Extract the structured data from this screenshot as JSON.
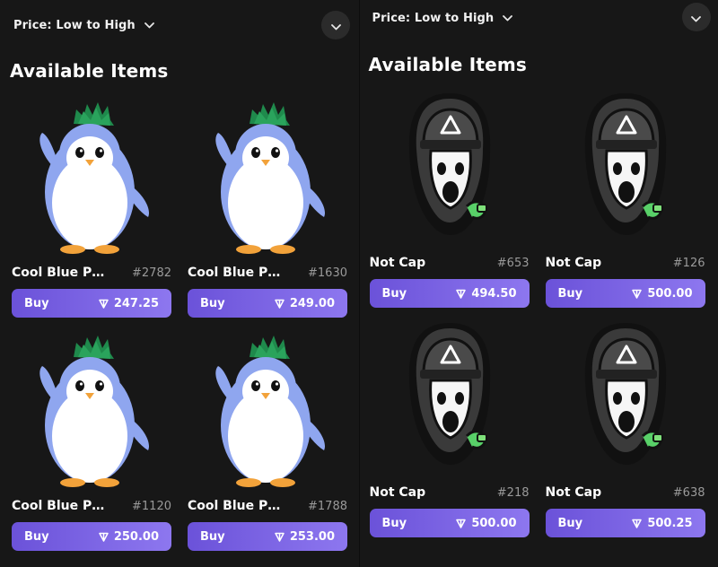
{
  "left_panel": {
    "sort": {
      "label": "Price: Low to High"
    },
    "section_title": "Available Items",
    "items": [
      {
        "name": "Cool Blue Pe...",
        "number": "#2782",
        "buy_label": "Buy",
        "price": "247.25",
        "art": "penguin"
      },
      {
        "name": "Cool Blue Pe...",
        "number": "#1630",
        "buy_label": "Buy",
        "price": "249.00",
        "art": "penguin"
      },
      {
        "name": "Cool Blue Pe...",
        "number": "#1120",
        "buy_label": "Buy",
        "price": "250.00",
        "art": "penguin"
      },
      {
        "name": "Cool Blue Pe...",
        "number": "#1788",
        "buy_label": "Buy",
        "price": "253.00",
        "art": "penguin"
      }
    ]
  },
  "right_panel": {
    "sort": {
      "label": "Price: Low to High"
    },
    "section_title": "Available Items",
    "items": [
      {
        "name": "Not Cap",
        "number": "#653",
        "buy_label": "Buy",
        "price": "494.50",
        "art": "notcap"
      },
      {
        "name": "Not Cap",
        "number": "#126",
        "buy_label": "Buy",
        "price": "500.00",
        "art": "notcap"
      },
      {
        "name": "Not Cap",
        "number": "#218",
        "buy_label": "Buy",
        "price": "500.00",
        "art": "notcap"
      },
      {
        "name": "Not Cap",
        "number": "#638",
        "buy_label": "Buy",
        "price": "500.25",
        "art": "notcap"
      }
    ]
  },
  "icons": {
    "sort_chevron": "chevron-down-icon",
    "collapse_button": "chevron-down-icon",
    "currency": "ton-icon"
  },
  "colors": {
    "background": "#171717",
    "buy_button_start": "#6b52d9",
    "buy_button_end": "#8d77ef",
    "item_number": "#9a9a9a"
  }
}
